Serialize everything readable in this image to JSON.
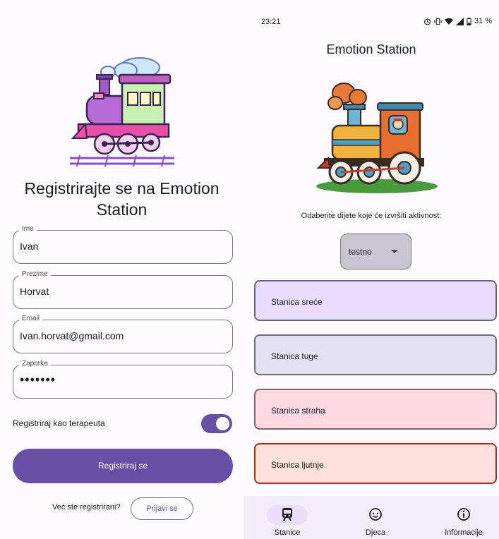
{
  "registration": {
    "title": "Registrirajte se na Emotion Station",
    "fields": [
      {
        "label": "Ime",
        "value": "Ivan"
      },
      {
        "label": "Prezime",
        "value": "Horvat"
      },
      {
        "label": "Email",
        "value": "Ivan.horvat@gmail.com"
      },
      {
        "label": "Zaporka",
        "value": "•••••••"
      }
    ],
    "therapist_toggle_label": "Registriraj kao terapeuta",
    "therapist_toggle_on": true,
    "register_button": "Registriraj se",
    "already_registered": "Već ste registrirani?",
    "login_button": "Prijavi se"
  },
  "status_bar": {
    "time": "23:21",
    "battery": "31 %"
  },
  "app": {
    "title": "Emotion Station",
    "choose_child_label": "Odaberite dijete koje će izvršiti aktivnost:",
    "child_dropdown_value": "testno",
    "stations": [
      {
        "label": "Stanica sreće",
        "bg": "#e9ddff",
        "border": "#6d6181"
      },
      {
        "label": "Stanica tuge",
        "bg": "#e4e1f6",
        "border": "#6d6a80"
      },
      {
        "label": "Stanica straha",
        "bg": "#ffd9e2",
        "border": "#7e6368"
      },
      {
        "label": "Stanica ljutnje",
        "bg": "#ffe1db",
        "border": "#b3261e"
      }
    ]
  },
  "bottom_nav": {
    "items": [
      {
        "label": "Stanice",
        "icon": "train-icon",
        "active": true
      },
      {
        "label": "Djeca",
        "icon": "child-face-icon",
        "active": false
      },
      {
        "label": "Informacije",
        "icon": "info-icon",
        "active": false
      }
    ],
    "active_pill_color": "#e8def8"
  }
}
